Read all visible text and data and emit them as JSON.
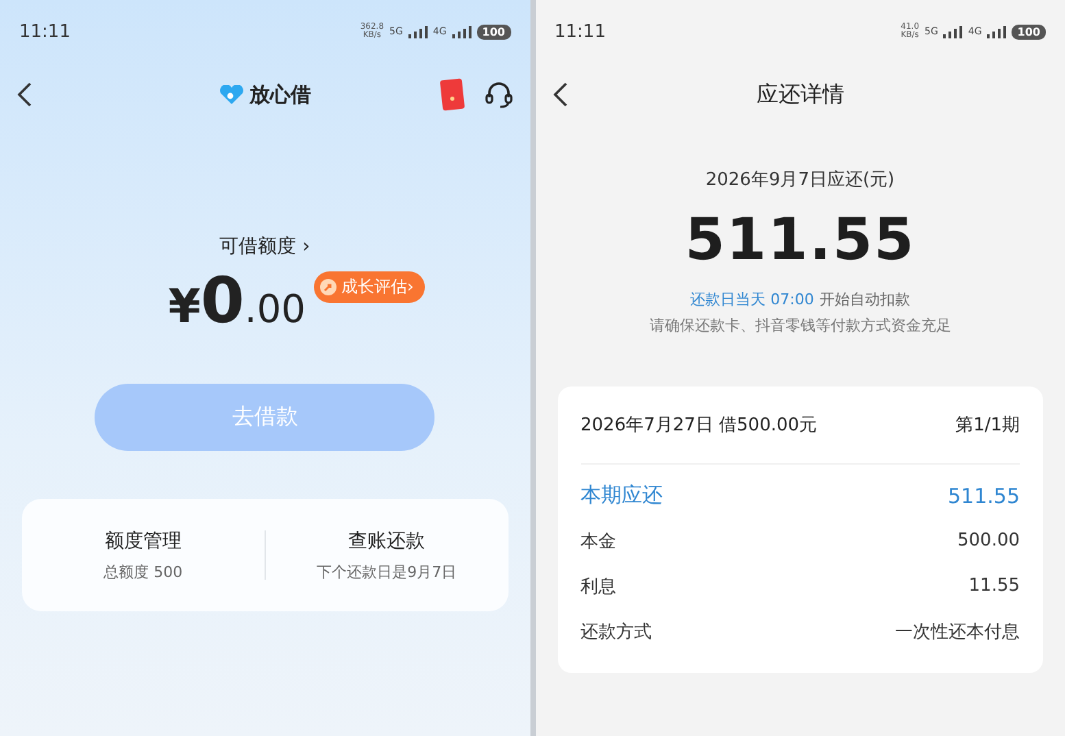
{
  "left_screen": {
    "status_bar": {
      "time": "11:11",
      "speed_value": "362.8",
      "speed_unit": "KB/s",
      "network_1": "5G",
      "network_2": "4G",
      "battery": "100"
    },
    "header": {
      "title": "放心借"
    },
    "credit": {
      "label": "可借额度 ›",
      "currency": "¥",
      "integer": "0",
      "decimal": ".00",
      "badge": "成长评估›"
    },
    "borrow_button": {
      "label": "去借款",
      "disabled": true
    },
    "shortcuts": [
      {
        "title": "额度管理",
        "subtitle": "总额度 500"
      },
      {
        "title": "查账还款",
        "subtitle": "下个还款日是9月7日"
      }
    ]
  },
  "right_screen": {
    "status_bar": {
      "time": "11:11",
      "speed_value": "41.0",
      "speed_unit": "KB/s",
      "network_1": "5G",
      "network_2": "4G",
      "battery": "100"
    },
    "header": {
      "title": "应还详情"
    },
    "due": {
      "label": "2026年9月7日应还(元)",
      "amount": "511.55",
      "note_highlight": "还款日当天 07:00",
      "note_text": "开始自动扣款",
      "reminder": "请确保还款卡、抖音零钱等付款方式资金充足"
    },
    "loan": {
      "summary": "2026年7月27日 借500.00元",
      "period": "第1/1期",
      "rows": [
        {
          "kind": "highlight",
          "label": "本期应还",
          "value": "511.55"
        },
        {
          "kind": "normal",
          "label": "本金",
          "value": "500.00"
        },
        {
          "kind": "normal",
          "label": "利息",
          "value": "11.55"
        },
        {
          "kind": "normal",
          "label": "还款方式",
          "value": "一次性还本付息"
        }
      ]
    }
  }
}
